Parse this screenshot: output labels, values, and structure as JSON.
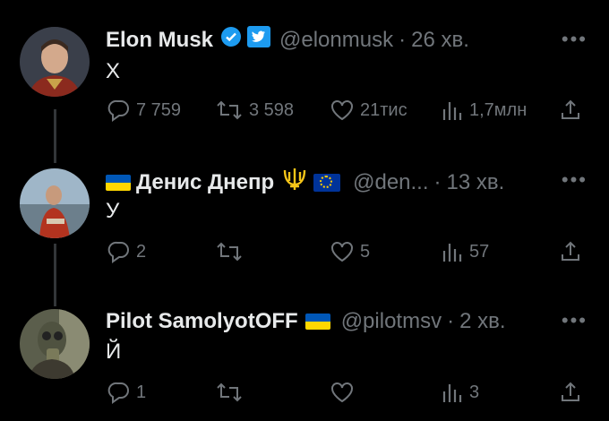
{
  "tweets": [
    {
      "name": "Elon Musk",
      "handle": "@elonmusk",
      "dot": "·",
      "time": "26 хв.",
      "text": "Х",
      "replies": "7 759",
      "retweets": "3 598",
      "likes": "21тис",
      "views": "1,7млн"
    },
    {
      "name": "Денис Днепр",
      "handle": "@den...",
      "dot": "·",
      "time": "13 хв.",
      "text": "У",
      "replies": "2",
      "retweets": "",
      "likes": "5",
      "views": "57"
    },
    {
      "name": "Pilot SamolyotOFF",
      "handle": "@pilotmsv",
      "dot": "·",
      "time": "2 хв.",
      "text": "Й",
      "replies": "1",
      "retweets": "",
      "likes": "",
      "views": "3"
    }
  ],
  "more_glyph": "•••",
  "colors": {
    "background": "#000000",
    "text": "#e7e9ea",
    "muted": "#71767b",
    "verified": "#1d9bf0",
    "thread_line": "#333639"
  },
  "icons": [
    "verified-badge-icon",
    "twitter-bird-icon",
    "reply-icon",
    "retweet-icon",
    "like-icon",
    "views-icon",
    "share-icon",
    "more-icon",
    "ukraine-flag-icon",
    "trident-icon",
    "eu-flag-icon"
  ]
}
